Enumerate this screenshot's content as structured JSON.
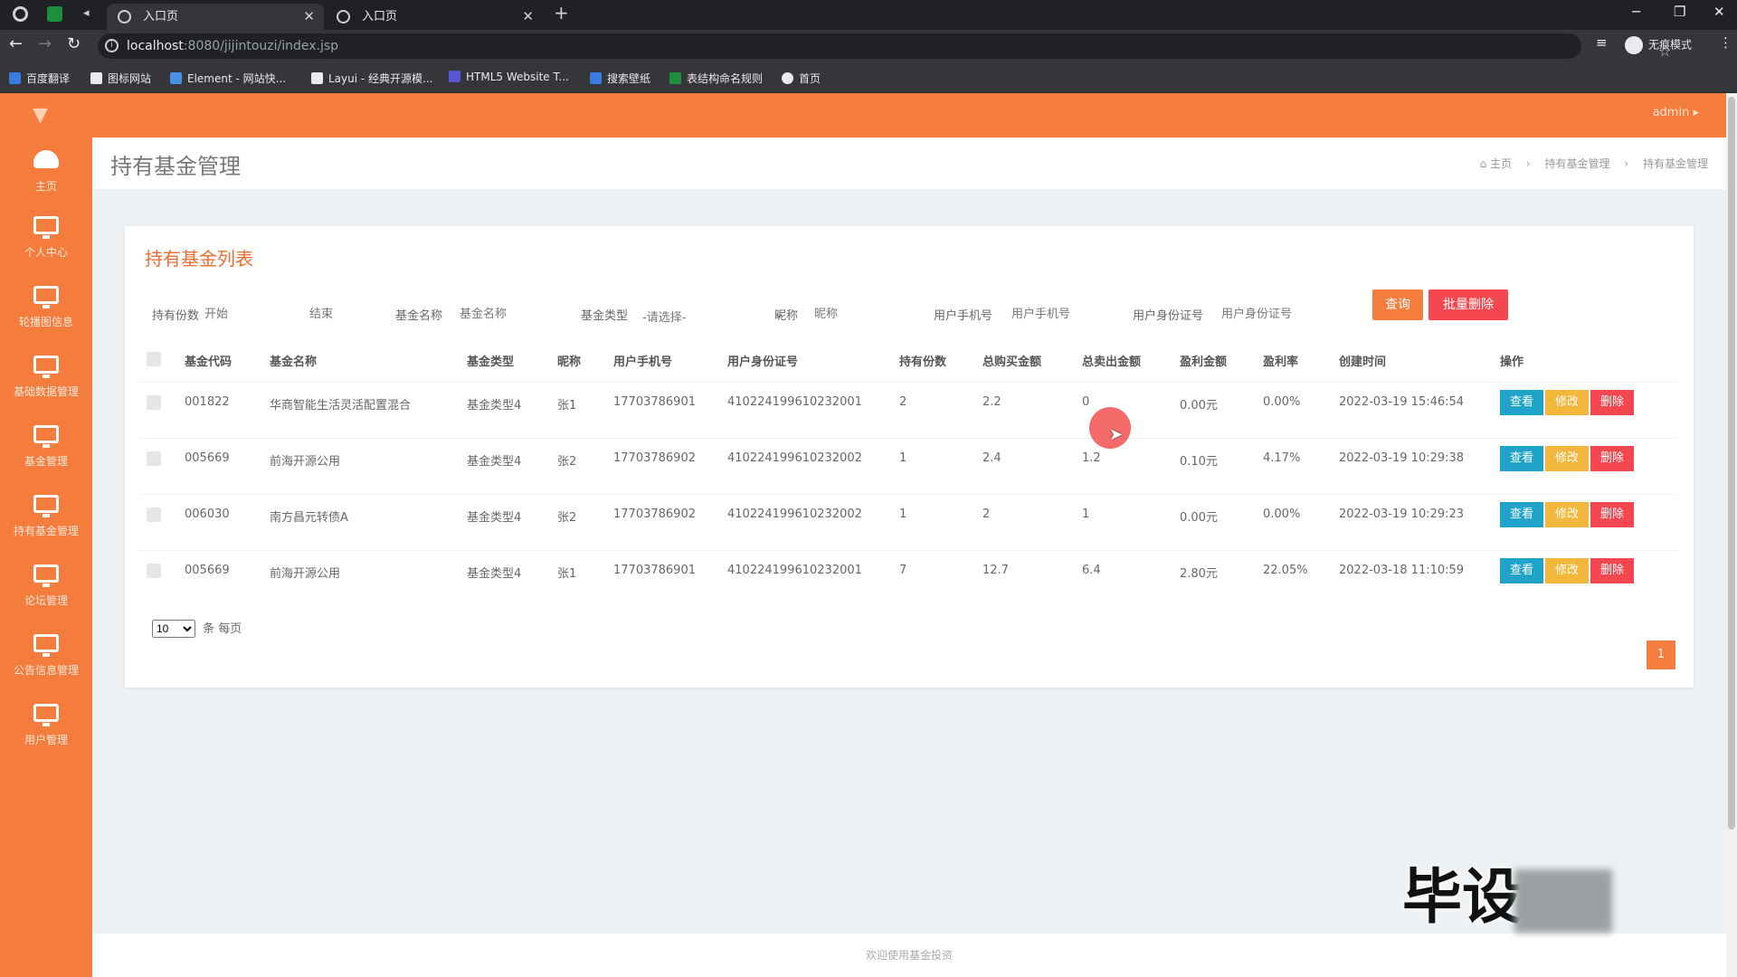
{
  "browser": {
    "tabs": [
      {
        "title": "入口页",
        "active": true
      },
      {
        "title": "入口页",
        "active": false
      }
    ],
    "url_host": "localhost",
    "url_path": ":8080/jijintouzi/index.jsp",
    "incognito_label": "无痕模式",
    "bookmarks": [
      "百度翻译",
      "图标网站",
      "Element - 网站快...",
      "Layui - 经典开源模...",
      "HTML5 Website T...",
      "搜索壁纸",
      "表结构命名规则",
      "首页"
    ]
  },
  "header": {
    "user": "admin"
  },
  "sidebar": {
    "items": [
      {
        "label": "主页",
        "icon": "dashboard-icon"
      },
      {
        "label": "个人中心",
        "icon": "monitor-icon"
      },
      {
        "label": "轮播图信息",
        "icon": "monitor-icon"
      },
      {
        "label": "基础数据管理",
        "icon": "monitor-icon"
      },
      {
        "label": "基金管理",
        "icon": "monitor-icon"
      },
      {
        "label": "持有基金管理",
        "icon": "monitor-icon"
      },
      {
        "label": "论坛管理",
        "icon": "monitor-icon"
      },
      {
        "label": "公告信息管理",
        "icon": "monitor-icon"
      },
      {
        "label": "用户管理",
        "icon": "monitor-icon"
      }
    ]
  },
  "page": {
    "title": "持有基金管理",
    "breadcrumb": [
      "主页",
      "持有基金管理",
      "持有基金管理"
    ],
    "panel_title": "持有基金列表"
  },
  "filters": {
    "holding_label": "持有份数",
    "holding_start_placeholder": "开始",
    "holding_end_placeholder": "结束",
    "fund_name_label": "基金名称",
    "fund_name_placeholder": "基金名称",
    "fund_type_label": "基金类型",
    "fund_type_value": "-请选择-",
    "nickname_label": "昵称",
    "nickname_placeholder": "昵称",
    "phone_label": "用户手机号",
    "phone_placeholder": "用户手机号",
    "idcard_label": "用户身份证号",
    "idcard_placeholder": "用户身份证号",
    "search_button": "查询",
    "bulk_delete_button": "批量删除"
  },
  "table": {
    "headers": [
      "基金代码",
      "基金名称",
      "基金类型",
      "昵称",
      "用户手机号",
      "用户身份证号",
      "持有份数",
      "总购买金额",
      "总卖出金额",
      "盈利金额",
      "盈利率",
      "创建时间",
      "操作"
    ],
    "rows": [
      {
        "code": "001822",
        "name": "华商智能生活灵活配置混合",
        "type": "基金类型4",
        "nick": "张1",
        "phone": "17703786901",
        "idcard": "410224199610232001",
        "shares": "2",
        "buy": "2.2",
        "sell": "0",
        "profit": "0.00元",
        "rate": "0.00%",
        "created": "2022-03-19 15:46:54"
      },
      {
        "code": "005669",
        "name": "前海开源公用",
        "type": "基金类型4",
        "nick": "张2",
        "phone": "17703786902",
        "idcard": "410224199610232002",
        "shares": "1",
        "buy": "2.4",
        "sell": "1.2",
        "profit": "0.10元",
        "rate": "4.17%",
        "created": "2022-03-19 10:29:38"
      },
      {
        "code": "006030",
        "name": "南方昌元转债A",
        "type": "基金类型4",
        "nick": "张2",
        "phone": "17703786902",
        "idcard": "410224199610232002",
        "shares": "1",
        "buy": "2",
        "sell": "1",
        "profit": "0.00元",
        "rate": "0.00%",
        "created": "2022-03-19 10:29:23"
      },
      {
        "code": "005669",
        "name": "前海开源公用",
        "type": "基金类型4",
        "nick": "张1",
        "phone": "17703786901",
        "idcard": "410224199610232001",
        "shares": "7",
        "buy": "12.7",
        "sell": "6.4",
        "profit": "2.80元",
        "rate": "22.05%",
        "created": "2022-03-18 11:10:59"
      }
    ],
    "actions": {
      "view": "查看",
      "edit": "修改",
      "delete": "删除"
    }
  },
  "pagination": {
    "page_size": "10",
    "page_size_suffix": "条 每页",
    "current_page": "1"
  },
  "footer": {
    "text": "欢迎使用基金投资"
  },
  "watermark": {
    "text": "毕设"
  },
  "colors": {
    "accent": "#f47c3c",
    "danger": "#f4474f",
    "info": "#1fa3c9",
    "warning": "#f3b73c"
  }
}
